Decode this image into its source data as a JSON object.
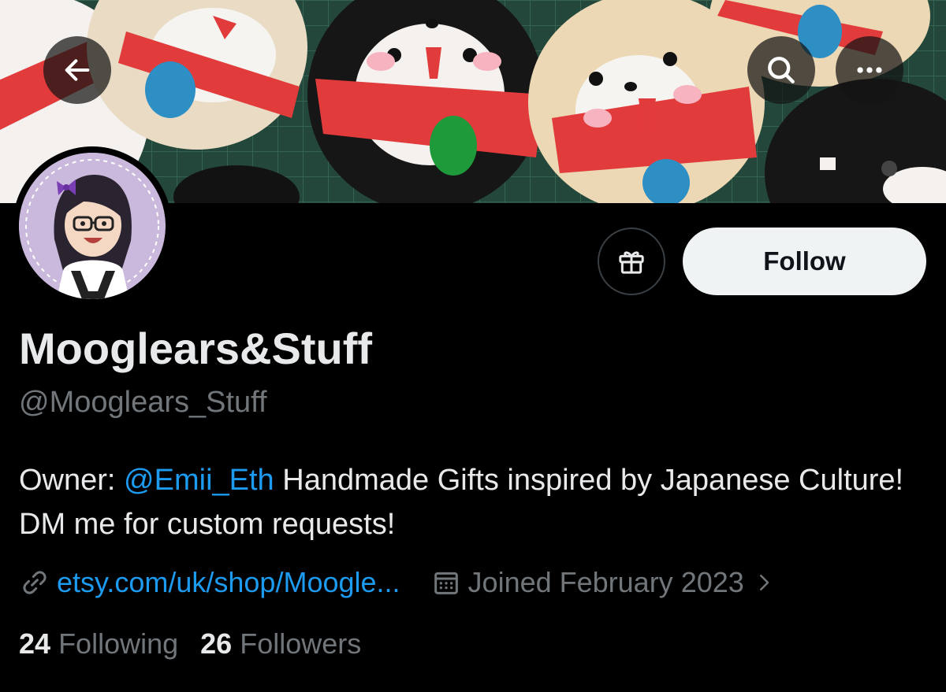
{
  "profile": {
    "display_name": "Mooglears&Stuff",
    "handle": "@Mooglears_Stuff",
    "bio_prefix": "Owner: ",
    "bio_mention": "@Emii_Eth",
    "bio_rest": " Handmade Gifts inspired by Japanese Culture! DM me for custom requests!",
    "website": "etsy.com/uk/shop/Moogle...",
    "joined": "Joined February 2023"
  },
  "actions": {
    "follow_label": "Follow"
  },
  "stats": {
    "following_count": "24",
    "following_label": "Following",
    "followers_count": "26",
    "followers_label": "Followers"
  },
  "icons": {
    "back": "arrow-left-icon",
    "search": "search-icon",
    "more": "more-icon",
    "gift": "gift-icon",
    "link": "link-icon",
    "calendar": "calendar-icon",
    "chevron": "chevron-right-icon"
  },
  "colors": {
    "background": "#000000",
    "accent": "#1d9bf0",
    "text_primary": "#e7e9ea",
    "text_secondary": "#71767b",
    "follow_button_bg": "#eff3f4"
  }
}
